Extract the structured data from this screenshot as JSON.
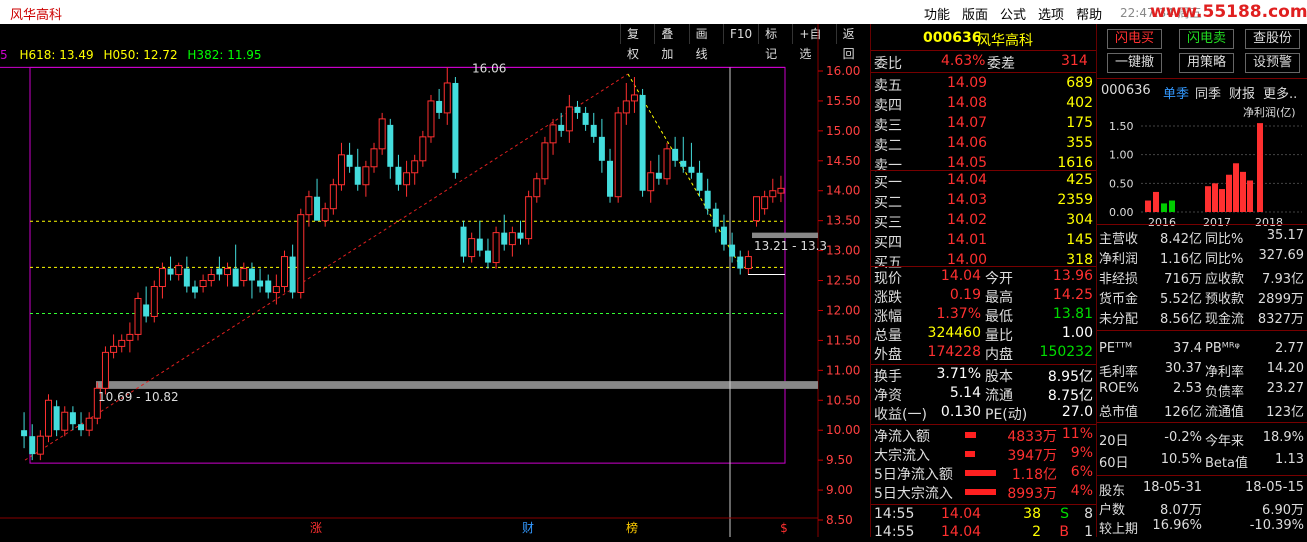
{
  "app": {
    "title": "风华高科",
    "menu": [
      "功能",
      "版面",
      "公式",
      "选项",
      "帮助"
    ],
    "clock": "22:47:34 周五",
    "watermark": "www.55188.com"
  },
  "chart": {
    "indicator": {
      "prefix": "5",
      "h618": "H618: 13.49",
      "h050": "H050: 12.72",
      "h382": "H382: 11.95"
    },
    "toolbar": [
      "复权",
      "叠加",
      "画线",
      "F10",
      "标记",
      "+自选",
      "返回"
    ],
    "ylabels": [
      "16.00",
      "15.50",
      "15.00",
      "14.50",
      "14.00",
      "13.50",
      "13.00",
      "12.50",
      "12.00",
      "11.50",
      "11.00",
      "10.50",
      "10.00",
      "9.50",
      "9.00",
      "8.50"
    ],
    "annotations": {
      "high": "16.06",
      "band_low": "10.69 - 10.82",
      "band_high": "13.21 - 13.3"
    },
    "markers": [
      "涨",
      "财",
      "榜",
      "$"
    ]
  },
  "quote": {
    "code": "000636",
    "name": "风华高科",
    "weibi": {
      "label": "委比",
      "value": "4.63%",
      "label2": "委差",
      "value2": "314"
    },
    "sell": [
      {
        "label": "卖五",
        "price": "14.09",
        "vol": "689"
      },
      {
        "label": "卖四",
        "price": "14.08",
        "vol": "402"
      },
      {
        "label": "卖三",
        "price": "14.07",
        "vol": "175"
      },
      {
        "label": "卖二",
        "price": "14.06",
        "vol": "355"
      },
      {
        "label": "卖一",
        "price": "14.05",
        "vol": "1616"
      }
    ],
    "buy": [
      {
        "label": "买一",
        "price": "14.04",
        "vol": "425"
      },
      {
        "label": "买二",
        "price": "14.03",
        "vol": "2359"
      },
      {
        "label": "买三",
        "price": "14.02",
        "vol": "304"
      },
      {
        "label": "买四",
        "price": "14.01",
        "vol": "145"
      },
      {
        "label": "买五",
        "price": "14.00",
        "vol": "318"
      }
    ],
    "stats": [
      {
        "l1": "现价",
        "v1": "14.04",
        "c1": "red",
        "l2": "今开",
        "v2": "13.96",
        "c2": "red"
      },
      {
        "l1": "涨跌",
        "v1": "0.19",
        "c1": "red",
        "l2": "最高",
        "v2": "14.25",
        "c2": "red"
      },
      {
        "l1": "涨幅",
        "v1": "1.37%",
        "c1": "red",
        "l2": "最低",
        "v2": "13.81",
        "c2": "grn"
      },
      {
        "l1": "总量",
        "v1": "324460",
        "c1": "yel",
        "l2": "量比",
        "v2": "1.00",
        "c2": "wht"
      },
      {
        "l1": "外盘",
        "v1": "174228",
        "c1": "red",
        "l2": "内盘",
        "v2": "150232",
        "c2": "grn"
      }
    ],
    "stats2": [
      {
        "l1": "换手",
        "v1": "3.71%",
        "l2": "股本",
        "v2": "8.95亿"
      },
      {
        "l1": "净资",
        "v1": "5.14",
        "l2": "流通",
        "v2": "8.75亿"
      },
      {
        "l1": "收益(一)",
        "v1": "0.130",
        "l2": "PE(动)",
        "v2": "27.0"
      }
    ],
    "flows": [
      {
        "label": "净流入额",
        "value": "4833万",
        "pct": "11%",
        "bar": 0.06
      },
      {
        "label": "大宗流入",
        "value": "3947万",
        "pct": "9%",
        "bar": 0.05
      },
      {
        "label": "5日净流入额",
        "value": "1.18亿",
        "pct": "6%",
        "bar": 0.5
      },
      {
        "label": "5日大宗流入",
        "value": "8993万",
        "pct": "4%",
        "bar": 0.5
      }
    ],
    "ticks": [
      {
        "time": "14:55",
        "price": "14.04",
        "vol": "38",
        "side": "S",
        "n": "8"
      },
      {
        "time": "14:55",
        "price": "14.04",
        "vol": "2",
        "side": "B",
        "n": "1"
      }
    ]
  },
  "fundamentals": {
    "buttons": [
      "闪电买",
      "闪电卖",
      "查股份",
      "一键撤",
      "用策略",
      "设预警"
    ],
    "code": "000636",
    "tabs": [
      "单季",
      "同季",
      "财报",
      "更多.."
    ],
    "mini_chart": {
      "ylabel": "净利润(亿)",
      "yticks": [
        "1.50",
        "1.00",
        "0.50",
        "0.00"
      ],
      "xlabels": [
        "2016",
        "2017",
        "2018"
      ]
    },
    "rows": [
      {
        "l1": "主营收",
        "v1": "8.42亿",
        "l2": "同比%",
        "v2": "35.17"
      },
      {
        "l1": "净利润",
        "v1": "1.16亿",
        "l2": "同比%",
        "v2": "327.69"
      },
      {
        "l1": "非经损",
        "v1": "716万",
        "l2": "应收款",
        "v2": "7.93亿"
      },
      {
        "l1": "货币金",
        "v1": "5.52亿",
        "l2": "预收款",
        "v2": "2899万"
      },
      {
        "l1": "未分配",
        "v1": "8.56亿",
        "l2": "现金流",
        "v2": "8327万"
      }
    ],
    "rows2": [
      {
        "l1": "PEᵀᵀᴹ",
        "v1": "37.4",
        "l2": "PBᴹᴿᵠ",
        "v2": "2.77"
      },
      {
        "l1": "毛利率",
        "v1": "30.37",
        "l2": "净利率",
        "v2": "14.20"
      },
      {
        "l1": "ROE%",
        "v1": "2.53",
        "l2": "负债率",
        "v2": "23.27"
      },
      {
        "l1": "总市值",
        "v1": "126亿",
        "l2": "流通值",
        "v2": "123亿"
      }
    ],
    "rows3": [
      {
        "l1": "20日",
        "v1": "-0.2%",
        "l2": "今年来",
        "v2": "18.9%"
      },
      {
        "l1": "60日",
        "v1": "10.5%",
        "l2": "Beta值",
        "v2": "1.13"
      }
    ],
    "rows4": [
      {
        "l1": "股东",
        "v1": "18-05-31",
        "l2": "",
        "v2": "18-05-15"
      },
      {
        "l1": "户数",
        "v1": "8.07万",
        "l2": "",
        "v2": "6.90万"
      },
      {
        "l1": "较上期",
        "v1": "16.96%",
        "l2": "",
        "v2": "-10.39%"
      }
    ]
  },
  "chart_data": {
    "type": "candlestick",
    "ylim": [
      8.5,
      16.0
    ],
    "candles": [
      {
        "o": 10.0,
        "h": 10.3,
        "l": 9.7,
        "c": 9.9
      },
      {
        "o": 9.9,
        "h": 10.1,
        "l": 9.5,
        "c": 9.6
      },
      {
        "o": 9.6,
        "h": 10.0,
        "l": 9.5,
        "c": 9.9
      },
      {
        "o": 9.9,
        "h": 10.6,
        "l": 9.8,
        "c": 10.5
      },
      {
        "o": 10.4,
        "h": 10.5,
        "l": 9.9,
        "c": 10.0
      },
      {
        "o": 10.0,
        "h": 10.4,
        "l": 9.9,
        "c": 10.3
      },
      {
        "o": 10.3,
        "h": 10.4,
        "l": 10.0,
        "c": 10.1
      },
      {
        "o": 10.1,
        "h": 10.3,
        "l": 9.9,
        "c": 10.0
      },
      {
        "o": 10.0,
        "h": 10.3,
        "l": 9.9,
        "c": 10.2
      },
      {
        "o": 10.2,
        "h": 10.8,
        "l": 10.1,
        "c": 10.7
      },
      {
        "o": 10.7,
        "h": 11.4,
        "l": 10.6,
        "c": 11.3
      },
      {
        "o": 11.3,
        "h": 11.6,
        "l": 11.2,
        "c": 11.4
      },
      {
        "o": 11.4,
        "h": 11.6,
        "l": 11.3,
        "c": 11.5
      },
      {
        "o": 11.5,
        "h": 11.8,
        "l": 11.3,
        "c": 11.6
      },
      {
        "o": 11.6,
        "h": 12.3,
        "l": 11.5,
        "c": 12.2
      },
      {
        "o": 12.1,
        "h": 12.4,
        "l": 11.8,
        "c": 11.9
      },
      {
        "o": 11.9,
        "h": 12.5,
        "l": 11.8,
        "c": 12.4
      },
      {
        "o": 12.4,
        "h": 12.8,
        "l": 12.2,
        "c": 12.7
      },
      {
        "o": 12.7,
        "h": 12.9,
        "l": 12.5,
        "c": 12.6
      },
      {
        "o": 12.6,
        "h": 12.8,
        "l": 12.5,
        "c": 12.75
      },
      {
        "o": 12.7,
        "h": 12.9,
        "l": 12.3,
        "c": 12.4
      },
      {
        "o": 12.4,
        "h": 12.5,
        "l": 12.2,
        "c": 12.3
      },
      {
        "o": 12.4,
        "h": 12.6,
        "l": 12.3,
        "c": 12.5
      },
      {
        "o": 12.5,
        "h": 12.7,
        "l": 12.4,
        "c": 12.6
      },
      {
        "o": 12.7,
        "h": 12.9,
        "l": 12.5,
        "c": 12.6
      },
      {
        "o": 12.6,
        "h": 12.8,
        "l": 12.4,
        "c": 12.7
      },
      {
        "o": 12.7,
        "h": 13.1,
        "l": 12.6,
        "c": 12.4
      },
      {
        "o": 12.5,
        "h": 12.8,
        "l": 12.4,
        "c": 12.7
      },
      {
        "o": 12.7,
        "h": 12.8,
        "l": 12.2,
        "c": 12.5
      },
      {
        "o": 12.5,
        "h": 12.7,
        "l": 12.3,
        "c": 12.4
      },
      {
        "o": 12.5,
        "h": 12.6,
        "l": 12.2,
        "c": 12.3
      },
      {
        "o": 12.3,
        "h": 12.6,
        "l": 12.1,
        "c": 12.4
      },
      {
        "o": 12.4,
        "h": 13.0,
        "l": 12.3,
        "c": 12.9
      },
      {
        "o": 12.9,
        "h": 13.1,
        "l": 12.2,
        "c": 12.3
      },
      {
        "o": 12.3,
        "h": 13.7,
        "l": 12.2,
        "c": 13.6
      },
      {
        "o": 13.6,
        "h": 14.0,
        "l": 13.4,
        "c": 13.9
      },
      {
        "o": 13.9,
        "h": 14.2,
        "l": 13.7,
        "c": 13.5
      },
      {
        "o": 13.5,
        "h": 13.8,
        "l": 13.4,
        "c": 13.7
      },
      {
        "o": 13.7,
        "h": 14.2,
        "l": 13.6,
        "c": 14.1
      },
      {
        "o": 14.1,
        "h": 14.8,
        "l": 14.0,
        "c": 14.6
      },
      {
        "o": 14.6,
        "h": 14.8,
        "l": 14.3,
        "c": 14.4
      },
      {
        "o": 14.4,
        "h": 14.7,
        "l": 14.0,
        "c": 14.1
      },
      {
        "o": 14.1,
        "h": 14.5,
        "l": 13.9,
        "c": 14.4
      },
      {
        "o": 14.4,
        "h": 14.8,
        "l": 14.3,
        "c": 14.7
      },
      {
        "o": 14.7,
        "h": 15.3,
        "l": 14.6,
        "c": 15.2
      },
      {
        "o": 15.1,
        "h": 15.2,
        "l": 14.2,
        "c": 14.4
      },
      {
        "o": 14.4,
        "h": 14.6,
        "l": 14.0,
        "c": 14.1
      },
      {
        "o": 14.1,
        "h": 14.5,
        "l": 13.9,
        "c": 14.3
      },
      {
        "o": 14.3,
        "h": 14.6,
        "l": 14.1,
        "c": 14.5
      },
      {
        "o": 14.5,
        "h": 15.0,
        "l": 14.4,
        "c": 14.9
      },
      {
        "o": 14.9,
        "h": 15.6,
        "l": 14.8,
        "c": 15.5
      },
      {
        "o": 15.5,
        "h": 15.7,
        "l": 15.2,
        "c": 15.3
      },
      {
        "o": 15.3,
        "h": 16.06,
        "l": 15.1,
        "c": 15.8
      },
      {
        "o": 15.8,
        "h": 15.9,
        "l": 14.2,
        "c": 14.3
      },
      {
        "o": 13.4,
        "h": 13.5,
        "l": 12.8,
        "c": 12.9
      },
      {
        "o": 12.9,
        "h": 13.3,
        "l": 12.8,
        "c": 13.2
      },
      {
        "o": 13.2,
        "h": 13.5,
        "l": 12.9,
        "c": 13.0
      },
      {
        "o": 13.0,
        "h": 13.2,
        "l": 12.7,
        "c": 12.8
      },
      {
        "o": 12.8,
        "h": 13.4,
        "l": 12.7,
        "c": 13.3
      },
      {
        "o": 13.3,
        "h": 13.6,
        "l": 13.0,
        "c": 13.1
      },
      {
        "o": 13.1,
        "h": 13.4,
        "l": 12.9,
        "c": 13.3
      },
      {
        "o": 13.3,
        "h": 13.5,
        "l": 13.1,
        "c": 13.2
      },
      {
        "o": 13.2,
        "h": 14.0,
        "l": 13.1,
        "c": 13.9
      },
      {
        "o": 13.9,
        "h": 14.3,
        "l": 13.8,
        "c": 14.2
      },
      {
        "o": 14.2,
        "h": 14.9,
        "l": 14.1,
        "c": 14.8
      },
      {
        "o": 14.8,
        "h": 15.2,
        "l": 14.6,
        "c": 15.1
      },
      {
        "o": 15.1,
        "h": 15.3,
        "l": 14.9,
        "c": 15.0
      },
      {
        "o": 15.0,
        "h": 15.6,
        "l": 14.8,
        "c": 15.4
      },
      {
        "o": 15.4,
        "h": 15.5,
        "l": 15.2,
        "c": 15.3
      },
      {
        "o": 15.3,
        "h": 15.4,
        "l": 15.0,
        "c": 15.1
      },
      {
        "o": 15.1,
        "h": 15.3,
        "l": 14.8,
        "c": 14.9
      },
      {
        "o": 14.9,
        "h": 15.2,
        "l": 14.3,
        "c": 14.5
      },
      {
        "o": 14.5,
        "h": 14.7,
        "l": 13.8,
        "c": 13.9
      },
      {
        "o": 13.9,
        "h": 15.4,
        "l": 13.8,
        "c": 15.3
      },
      {
        "o": 15.3,
        "h": 15.8,
        "l": 15.1,
        "c": 15.5
      },
      {
        "o": 15.5,
        "h": 15.9,
        "l": 15.3,
        "c": 15.6
      },
      {
        "o": 15.6,
        "h": 15.7,
        "l": 13.9,
        "c": 14.0
      },
      {
        "o": 14.0,
        "h": 14.5,
        "l": 13.8,
        "c": 14.3
      },
      {
        "o": 14.3,
        "h": 14.6,
        "l": 14.1,
        "c": 14.2
      },
      {
        "o": 14.2,
        "h": 14.8,
        "l": 14.1,
        "c": 14.7
      },
      {
        "o": 14.7,
        "h": 14.9,
        "l": 14.4,
        "c": 14.5
      },
      {
        "o": 14.5,
        "h": 14.9,
        "l": 14.3,
        "c": 14.4
      },
      {
        "o": 14.4,
        "h": 14.8,
        "l": 14.2,
        "c": 14.3
      },
      {
        "o": 14.3,
        "h": 14.5,
        "l": 13.9,
        "c": 14.0
      },
      {
        "o": 14.0,
        "h": 14.2,
        "l": 13.6,
        "c": 13.7
      },
      {
        "o": 13.7,
        "h": 13.8,
        "l": 13.3,
        "c": 13.4
      },
      {
        "o": 13.4,
        "h": 13.6,
        "l": 13.0,
        "c": 13.1
      },
      {
        "o": 13.1,
        "h": 13.3,
        "l": 12.8,
        "c": 12.9
      },
      {
        "o": 12.9,
        "h": 13.0,
        "l": 12.6,
        "c": 12.7
      },
      {
        "o": 12.7,
        "h": 13.0,
        "l": 12.6,
        "c": 12.9
      },
      {
        "o": 13.5,
        "h": 13.9,
        "l": 13.4,
        "c": 13.9
      },
      {
        "o": 13.7,
        "h": 14.0,
        "l": 13.6,
        "c": 13.9
      },
      {
        "o": 13.9,
        "h": 14.2,
        "l": 13.8,
        "c": 14.0
      },
      {
        "o": 13.96,
        "h": 14.25,
        "l": 13.81,
        "c": 14.04
      }
    ],
    "hlines": [
      {
        "y": 13.49,
        "label": "H618"
      },
      {
        "y": 12.72,
        "label": "H050"
      },
      {
        "y": 11.95,
        "label": "H382"
      }
    ],
    "support_band": [
      10.69,
      10.82
    ],
    "upper_band": [
      13.21,
      13.3
    ],
    "mini_bars": {
      "series": [
        {
          "name": "净利润(亿)",
          "values": [
            0.2,
            0.35,
            0.15,
            0.2,
            0.45,
            0.5,
            0.4,
            0.65,
            0.85,
            0.7,
            0.55,
            1.55
          ],
          "colors": [
            "#ff3030",
            "#ff3030",
            "#00cc00",
            "#00cc00",
            "#ff3030",
            "#ff3030",
            "#ff3030",
            "#ff3030",
            "#ff3030",
            "#ff3030",
            "#ff3030",
            "#ff3030"
          ]
        }
      ],
      "categories": [
        "2016",
        "2017",
        "2018"
      ],
      "ylim": [
        0,
        1.5
      ]
    }
  }
}
